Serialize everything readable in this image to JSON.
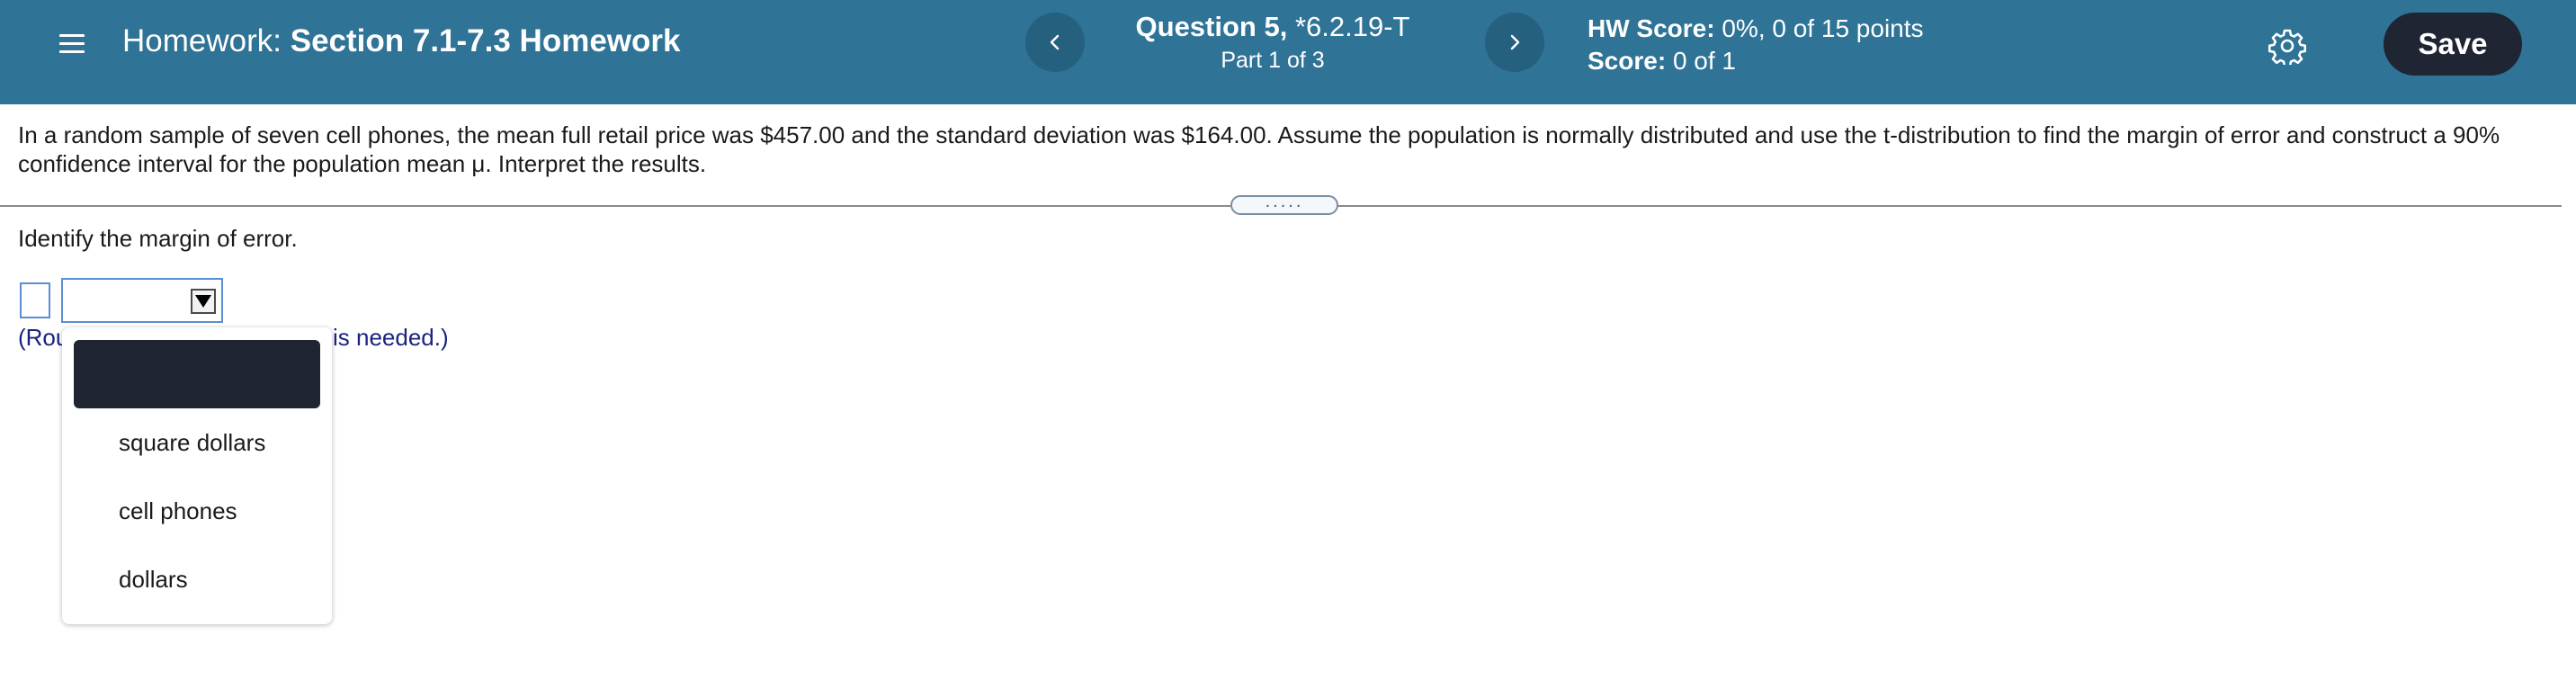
{
  "header": {
    "title_prefix": "Homework:",
    "title_name": "Section 7.1-7.3 Homework",
    "question_label": "Question 5,",
    "question_id": "*6.2.19-T",
    "part": "Part 1 of 3",
    "hw_score_label": "HW Score:",
    "hw_score_value": "0%, 0 of 15 points",
    "score_label": "Score:",
    "score_value": "0 of 1",
    "save_label": "Save",
    "colors": {
      "bar": "#2f7396",
      "nav_button": "#26607f",
      "save_button": "#1f2532"
    },
    "icons": {
      "menu": "hamburger-icon",
      "prev": "chevron-left-icon",
      "next": "chevron-right-icon",
      "settings": "gear-icon"
    }
  },
  "problem": {
    "text": "In a random sample of seven cell phones, the mean full retail price was $457.00 and the standard deviation was $164.00. Assume the population is normally distributed and use the t-distribution to find the margin of error and construct a 90% confidence interval for the population mean μ. Interpret the results."
  },
  "divider": {
    "handle": "....."
  },
  "answer": {
    "instruction": "Identify the margin of error.",
    "round_note_left": "(Rou",
    "round_note_right": "is needed.)",
    "units_dropdown": {
      "selected": "",
      "options": [
        "square dollars",
        "cell phones",
        "dollars"
      ]
    }
  }
}
